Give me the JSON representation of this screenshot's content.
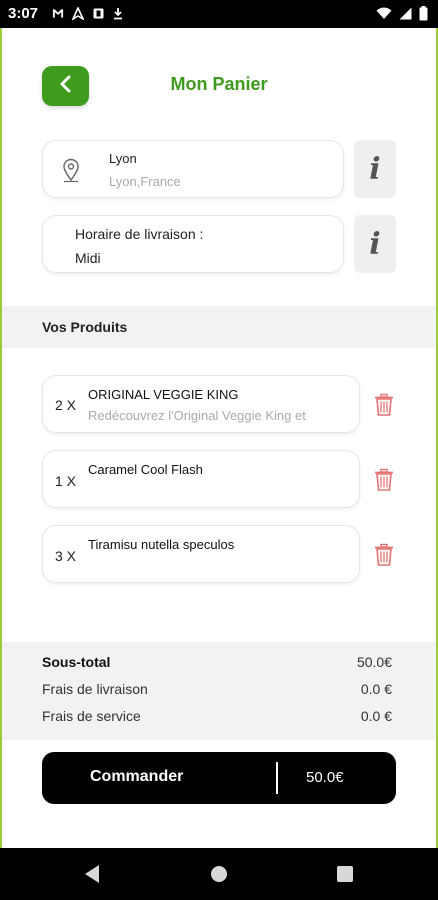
{
  "status_bar": {
    "time": "3:07",
    "left_icons": [
      "gmail-icon",
      "maps-icon",
      "app-icon",
      "download-icon"
    ],
    "right_icons": [
      "wifi-icon",
      "signal-icon",
      "battery-icon"
    ]
  },
  "header": {
    "title": "Mon Panier",
    "back_icon": "chevron-left-icon"
  },
  "address": {
    "city": "Lyon",
    "full": "Lyon,France",
    "icon": "location-pin-icon",
    "info_label": "i"
  },
  "schedule": {
    "label": "Horaire de livraison :",
    "value": "Midi",
    "info_label": "i"
  },
  "products_section": {
    "title": "Vos Produits"
  },
  "products": [
    {
      "qty": "2 X",
      "name": "ORIGINAL VEGGIE KING",
      "description": "Redécouvrez l'Original Veggie King et"
    },
    {
      "qty": "1 X",
      "name": "Caramel Cool Flash",
      "description": ""
    },
    {
      "qty": "3 X",
      "name": "Tiramisu nutella speculos",
      "description": ""
    }
  ],
  "totals": {
    "subtotal_label": "Sous-total",
    "subtotal_value": "50.0€",
    "delivery_label": "Frais de livraison",
    "delivery_value": "0.0 €",
    "service_label": "Frais de service",
    "service_value": "0.0 €"
  },
  "order_button": {
    "label": "Commander",
    "price": "50.0€"
  },
  "colors": {
    "brand_green": "#3e9b1e",
    "trash_red": "#e57373",
    "button_black": "#000000"
  },
  "nav": {
    "icons": [
      "nav-back-icon",
      "nav-home-icon",
      "nav-recents-icon"
    ]
  }
}
